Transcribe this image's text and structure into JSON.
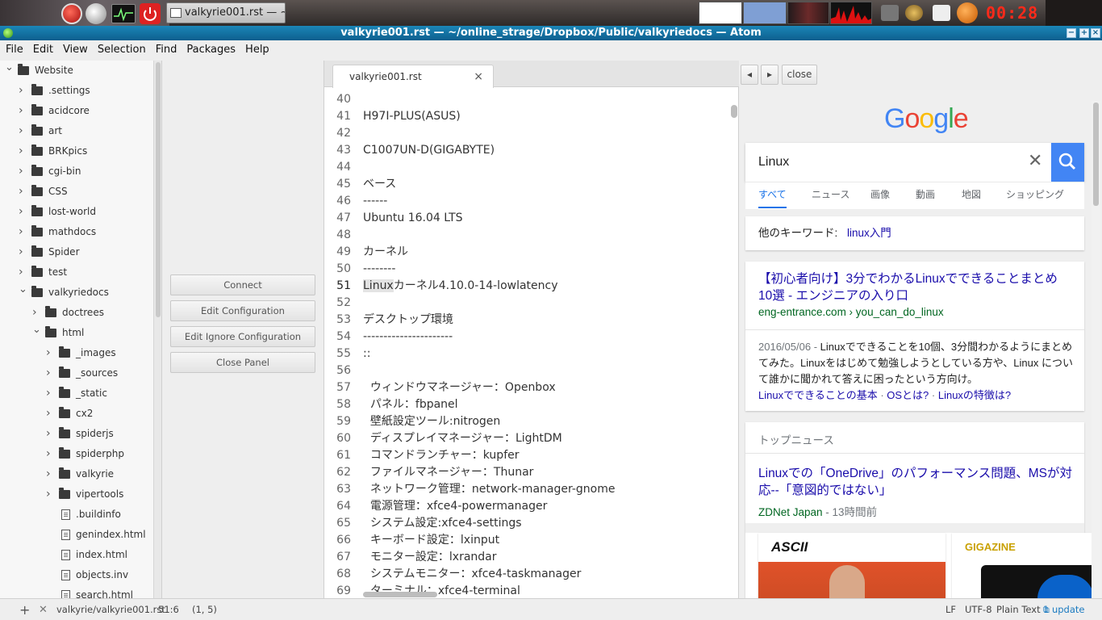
{
  "taskbar": {
    "window_task": "valkyrie001.rst — ~",
    "clock": "00:28"
  },
  "window": {
    "title": "valkyrie001.rst — ~/online_strage/Dropbox/Public/valkyriedocs — Atom",
    "minimize": "−",
    "maximize": "+",
    "close": "×"
  },
  "menu": [
    "File",
    "Edit",
    "View",
    "Selection",
    "Find",
    "Packages",
    "Help"
  ],
  "tree": [
    {
      "label": "Website",
      "depth": 0,
      "type": "folder",
      "open": true
    },
    {
      "label": ".settings",
      "depth": 1,
      "type": "folder"
    },
    {
      "label": "acidcore",
      "depth": 1,
      "type": "folder"
    },
    {
      "label": "art",
      "depth": 1,
      "type": "folder"
    },
    {
      "label": "BRKpics",
      "depth": 1,
      "type": "folder"
    },
    {
      "label": "cgi-bin",
      "depth": 1,
      "type": "folder"
    },
    {
      "label": "CSS",
      "depth": 1,
      "type": "folder"
    },
    {
      "label": "lost-world",
      "depth": 1,
      "type": "folder"
    },
    {
      "label": "mathdocs",
      "depth": 1,
      "type": "folder"
    },
    {
      "label": "Spider",
      "depth": 1,
      "type": "folder"
    },
    {
      "label": "test",
      "depth": 1,
      "type": "folder"
    },
    {
      "label": "valkyriedocs",
      "depth": 1,
      "type": "folder",
      "open": true
    },
    {
      "label": "doctrees",
      "depth": 2,
      "type": "folder"
    },
    {
      "label": "html",
      "depth": 2,
      "type": "folder",
      "open": true
    },
    {
      "label": "_images",
      "depth": 3,
      "type": "folder"
    },
    {
      "label": "_sources",
      "depth": 3,
      "type": "folder"
    },
    {
      "label": "_static",
      "depth": 3,
      "type": "folder"
    },
    {
      "label": "cx2",
      "depth": 3,
      "type": "folder"
    },
    {
      "label": "spiderjs",
      "depth": 3,
      "type": "folder"
    },
    {
      "label": "spiderphp",
      "depth": 3,
      "type": "folder"
    },
    {
      "label": "valkyrie",
      "depth": 3,
      "type": "folder"
    },
    {
      "label": "vipertools",
      "depth": 3,
      "type": "folder"
    },
    {
      "label": ".buildinfo",
      "depth": 3,
      "type": "file"
    },
    {
      "label": "genindex.html",
      "depth": 3,
      "type": "file"
    },
    {
      "label": "index.html",
      "depth": 3,
      "type": "file"
    },
    {
      "label": "objects.inv",
      "depth": 3,
      "type": "file"
    },
    {
      "label": "search.html",
      "depth": 3,
      "type": "file"
    }
  ],
  "panel_buttons": [
    "Connect",
    "Edit Configuration",
    "Edit Ignore Configuration",
    "Close Panel"
  ],
  "editor": {
    "tab_title": "valkyrie001.rst",
    "tab_close": "×",
    "lines": [
      {
        "n": "40",
        "t": ""
      },
      {
        "n": "41",
        "t": "H97I-PLUS(ASUS)"
      },
      {
        "n": "42",
        "t": ""
      },
      {
        "n": "43",
        "t": "C1007UN-D(GIGABYTE)"
      },
      {
        "n": "44",
        "t": ""
      },
      {
        "n": "45",
        "t": "ベース"
      },
      {
        "n": "46",
        "t": "------"
      },
      {
        "n": "47",
        "t": "Ubuntu 16.04 LTS"
      },
      {
        "n": "48",
        "t": ""
      },
      {
        "n": "49",
        "t": "カーネル"
      },
      {
        "n": "50",
        "t": "--------"
      },
      {
        "n": "51",
        "t": "カーネル4.10.0-14-lowlatency",
        "hl": "Linux"
      },
      {
        "n": "52",
        "t": ""
      },
      {
        "n": "53",
        "t": "デスクトップ環境"
      },
      {
        "n": "54",
        "t": "----------------------"
      },
      {
        "n": "55",
        "t": "::"
      },
      {
        "n": "56",
        "t": ""
      },
      {
        "n": "57",
        "t": "  ウィンドウマネージャー：Openbox"
      },
      {
        "n": "58",
        "t": "  パネル：fbpanel"
      },
      {
        "n": "59",
        "t": "  壁紙設定ツール:nitrogen"
      },
      {
        "n": "60",
        "t": "  ディスプレイマネージャー：LightDM"
      },
      {
        "n": "61",
        "t": "  コマンドランチャー：kupfer"
      },
      {
        "n": "62",
        "t": "  ファイルマネージャー：Thunar"
      },
      {
        "n": "63",
        "t": "  ネットワーク管理：network-manager-gnome"
      },
      {
        "n": "64",
        "t": "  電源管理：xfce4-powermanager"
      },
      {
        "n": "65",
        "t": "  システム設定:xfce4-settings"
      },
      {
        "n": "66",
        "t": "  キーボード設定：lxinput"
      },
      {
        "n": "67",
        "t": "  モニター設定：lxrandar"
      },
      {
        "n": "68",
        "t": "  システムモニター：xfce4-taskmanager"
      },
      {
        "n": "69",
        "t": "  ターミナル：xfce4-terminal"
      }
    ]
  },
  "browser": {
    "back": "◂",
    "forward": "▸",
    "close": "close",
    "logo_letters": [
      {
        "ch": "G",
        "color": "#4285f4"
      },
      {
        "ch": "o",
        "color": "#ea4335"
      },
      {
        "ch": "o",
        "color": "#fbbc05"
      },
      {
        "ch": "g",
        "color": "#4285f4"
      },
      {
        "ch": "l",
        "color": "#34a853"
      },
      {
        "ch": "e",
        "color": "#ea4335"
      }
    ],
    "query": "Linux",
    "clear": "✕",
    "tabs": [
      "すべて",
      "ニュース",
      "画像",
      "動画",
      "地図",
      "ショッピング"
    ],
    "related_label": "他のキーワード:",
    "related_link": "linux入門",
    "result": {
      "title": "【初心者向け】3分でわかるLinuxでできることまとめ 10選 - エンジニアの入り口",
      "url": "eng-entrance.com › you_can_do_linux",
      "date": "2016/05/06",
      "snippet": "Linuxでできることを10個、3分間わかるようにまとめてみた。Linuxをはじめて勉強しようとしている方や、Linux について誰かに聞かれて答えに困ったという方向け。",
      "sublinks": [
        "Linuxでできることの基本",
        "OSとは?",
        "Linuxの特徴は?"
      ]
    },
    "news": {
      "header": "トップニュース",
      "title": "Linuxでの「OneDrive」のパフォーマンス問題、MSが対応--「意図的ではない」",
      "source": "ZDNet Japan",
      "age": "13時間前",
      "thumb1_logo": "ASCII",
      "thumb2_logo": "GIGAZINE"
    }
  },
  "status": {
    "add": "+",
    "close": "✕",
    "file_path": "valkyrie/valkyrie001.rst",
    "cursor": "51:6",
    "selection": "(1, 5)",
    "line_ending": "LF",
    "encoding": "UTF-8",
    "grammar": "Plain Text",
    "update": "1 update"
  },
  "colors": {
    "title_bar": "#1b86b8",
    "google_blue": "#4285f4",
    "link": "#1a0dab",
    "result_url": "#006621",
    "clock": "#ff2a1a"
  }
}
